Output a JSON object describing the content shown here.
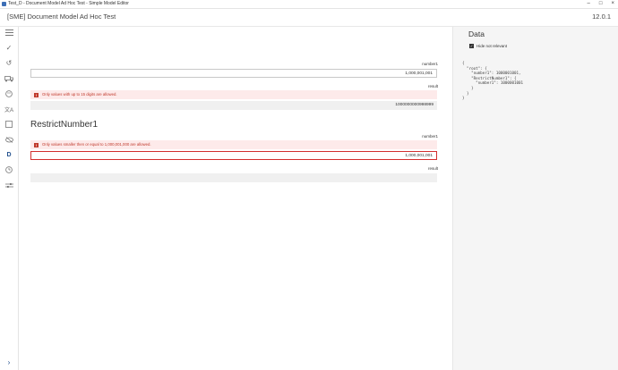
{
  "window": {
    "title": "Test_D - Document Model Ad Hoc Test - Simple Model Editor"
  },
  "header": {
    "title": "[SME] Document Model Ad Hoc Test",
    "version": "12.0.1"
  },
  "sidebar": {
    "icons": [
      "menu-icon",
      "check-icon",
      "history-icon",
      "truck-icon",
      "palette-icon",
      "translate-icon",
      "square-icon",
      "eye-off-icon",
      "d-icon",
      "clock-icon",
      "sliders-icon"
    ],
    "d_label": "D",
    "expand_label": "›"
  },
  "main": {
    "block1": {
      "label": "number1",
      "value": "1,000,001,001",
      "error": "Only values with up to 15 digits are allowed.",
      "result_label": "result",
      "result_value": "1000000000998999"
    },
    "block2": {
      "title": "RestrictNumber1",
      "label": "number1",
      "error": "Only values smaller then or equal to 1,000,001,000 are allowed.",
      "value": "1,000,001,001",
      "result_label": "result",
      "result_value": ""
    }
  },
  "data_panel": {
    "title": "Data",
    "checkbox_label": "Hide not relevant",
    "checkbox_checked": true,
    "json_text": "{\n  \"root\": {\n    \"number1\": 1000001001,\n    \"RestrictNumber1\": {\n      \"number1\": 1000001001\n    }\n  }\n}"
  },
  "colors": {
    "accent": "#1f4e8c",
    "error": "#c0392b",
    "error_bg": "#fdeaea"
  }
}
